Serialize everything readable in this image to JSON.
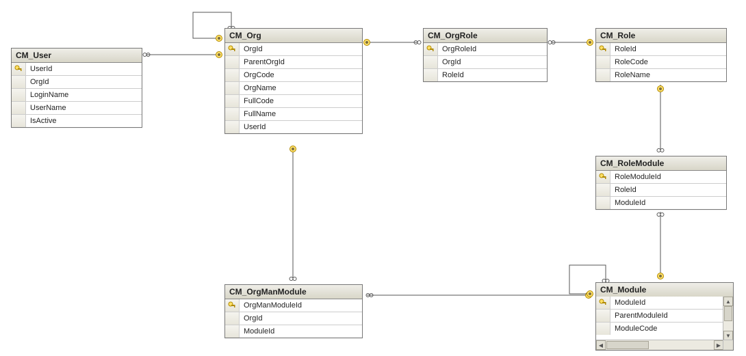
{
  "diagram": {
    "type": "ER diagram",
    "tables": {
      "cm_user": {
        "title": "CM_User",
        "columns": [
          {
            "name": "UserId",
            "pk": true
          },
          {
            "name": "OrgId"
          },
          {
            "name": "LoginName"
          },
          {
            "name": "UserName"
          },
          {
            "name": "IsActive"
          }
        ]
      },
      "cm_org": {
        "title": "CM_Org",
        "columns": [
          {
            "name": "OrgId",
            "pk": true
          },
          {
            "name": "ParentOrgId"
          },
          {
            "name": "OrgCode"
          },
          {
            "name": "OrgName"
          },
          {
            "name": "FullCode"
          },
          {
            "name": "FullName"
          },
          {
            "name": "UserId"
          }
        ]
      },
      "cm_orgrole": {
        "title": "CM_OrgRole",
        "columns": [
          {
            "name": "OrgRoleId",
            "pk": true
          },
          {
            "name": "OrgId"
          },
          {
            "name": "RoleId"
          }
        ]
      },
      "cm_role": {
        "title": "CM_Role",
        "columns": [
          {
            "name": "RoleId",
            "pk": true
          },
          {
            "name": "RoleCode"
          },
          {
            "name": "RoleName"
          }
        ]
      },
      "cm_rolemod": {
        "title": "CM_RoleModule",
        "columns": [
          {
            "name": "RoleModuleId",
            "pk": true
          },
          {
            "name": "RoleId"
          },
          {
            "name": "ModuleId"
          }
        ]
      },
      "cm_orgman": {
        "title": "CM_OrgManModule",
        "columns": [
          {
            "name": "OrgManModuleId",
            "pk": true
          },
          {
            "name": "OrgId"
          },
          {
            "name": "ModuleId"
          }
        ]
      },
      "cm_module": {
        "title": "CM_Module",
        "columns": [
          {
            "name": "ModuleId",
            "pk": true
          },
          {
            "name": "ParentModuleId"
          },
          {
            "name": "ModuleCode"
          }
        ]
      }
    },
    "relationships": [
      {
        "from": "CM_User.OrgId",
        "to": "CM_Org.OrgId"
      },
      {
        "from": "CM_Org.ParentOrgId",
        "to": "CM_Org.OrgId",
        "self": true
      },
      {
        "from": "CM_OrgRole.OrgId",
        "to": "CM_Org.OrgId"
      },
      {
        "from": "CM_OrgRole.RoleId",
        "to": "CM_Role.RoleId"
      },
      {
        "from": "CM_RoleModule.RoleId",
        "to": "CM_Role.RoleId"
      },
      {
        "from": "CM_RoleModule.ModuleId",
        "to": "CM_Module.ModuleId"
      },
      {
        "from": "CM_OrgManModule.OrgId",
        "to": "CM_Org.OrgId"
      },
      {
        "from": "CM_OrgManModule.ModuleId",
        "to": "CM_Module.ModuleId"
      },
      {
        "from": "CM_Module.ParentModuleId",
        "to": "CM_Module.ModuleId",
        "self": true
      }
    ]
  }
}
